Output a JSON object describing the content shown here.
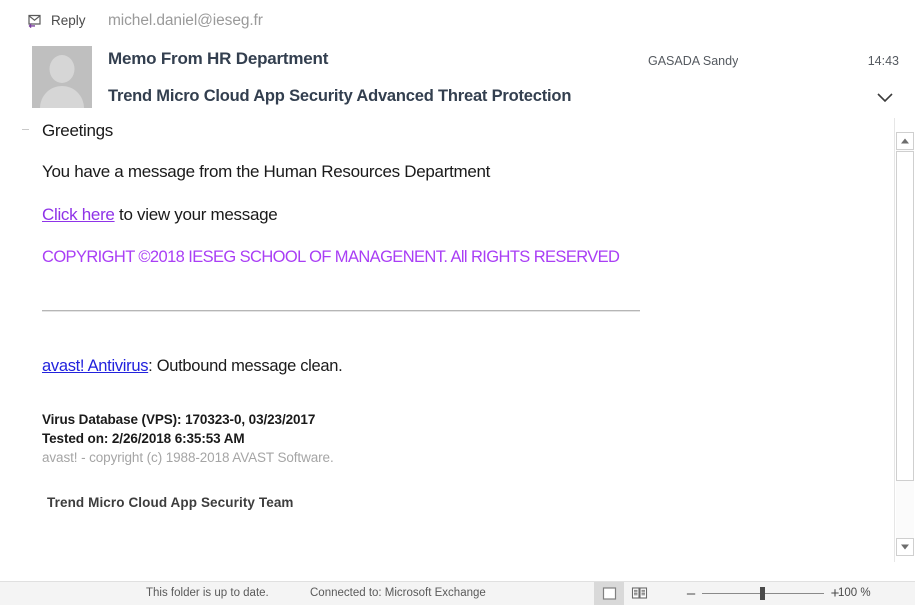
{
  "header": {
    "reply_label": "Reply",
    "reply_icon": "reply-envelope-icon",
    "from_address": "michel.daniel@ieseg.fr",
    "subject": "Memo From HR Department",
    "banner": "Trend Micro Cloud App Security Advanced Threat Protection",
    "sender_name": "GASADA Sandy",
    "time": "14:43",
    "expand_icon": "chevron-down-icon",
    "avatar_icon": "person-placeholder-avatar"
  },
  "body": {
    "greetings": "Greetings",
    "paragraph1": "You have a message from the Human Resources Department",
    "link_click_here": "Click here",
    "paragraph2_rest": " to view your message",
    "copyright": "COPYRIGHT ©2018 IESEG SCHOOL OF MANAGENENT. All RIGHTS RESERVED",
    "avast_link": "avast! Antivirus",
    "avast_rest": ": Outbound message clean.",
    "virus_db": "Virus Database (VPS): 170323-0, 03/23/2017",
    "tested_on": "Tested on: 2/26/2018 6:35:53 AM",
    "avast_copyright": "avast! - copyright (c) 1988-2018 AVAST Software.",
    "team_signature": "Trend Micro Cloud App Security Team"
  },
  "status_bar": {
    "folder_status": "This folder is up to date.",
    "connection_status": "Connected to: Microsoft Exchange",
    "normal_view_icon": "normal-view-icon",
    "reading_view_icon": "reading-view-icon",
    "zoom_out_label": "–",
    "zoom_in_label": "+",
    "zoom_percent": "100 %"
  },
  "scrollbar": {
    "up_icon": "scroll-up-arrow-icon",
    "down_icon": "scroll-down-arrow-icon"
  },
  "colors": {
    "link_purple": "#8f33e8",
    "copyright_purple": "#a93ef5",
    "link_blue": "#2222dd",
    "header_navy": "#333f4f",
    "accent_reply": "#7b3fa0"
  }
}
